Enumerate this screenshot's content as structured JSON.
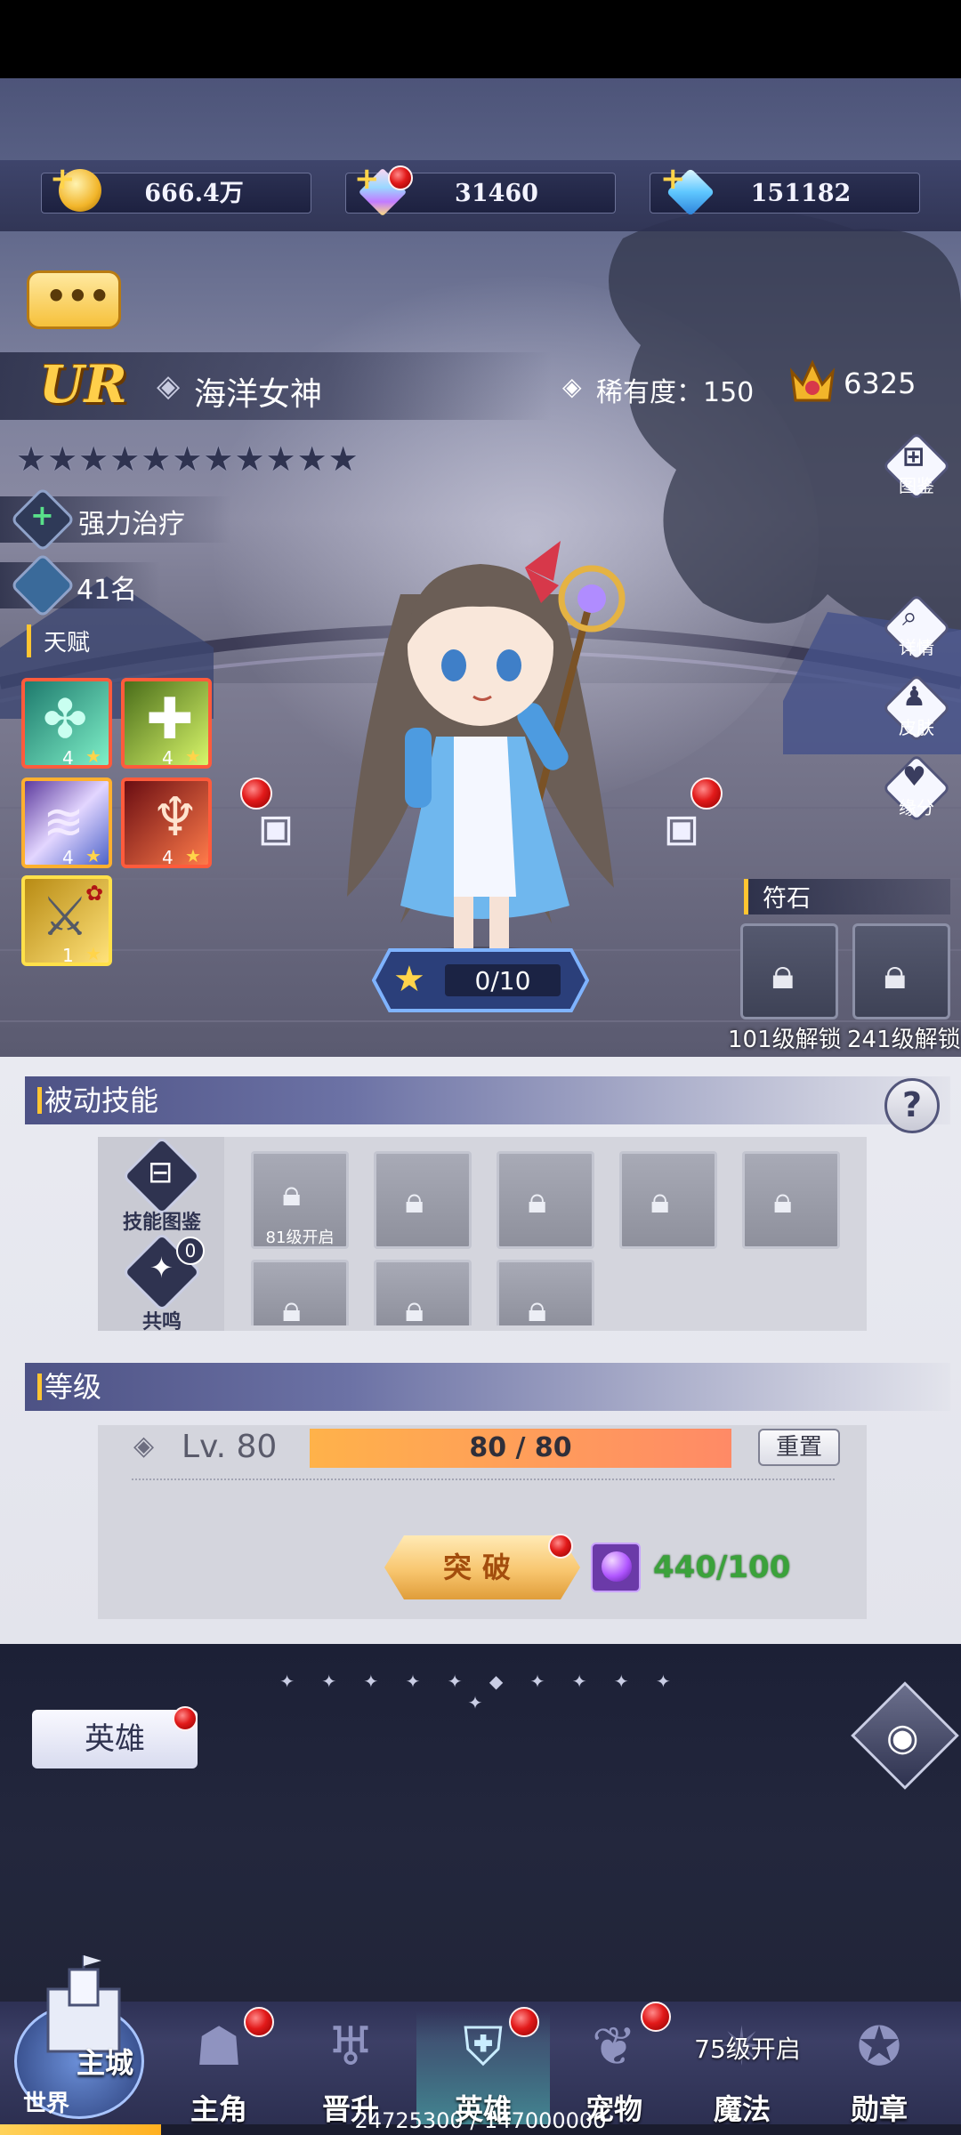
{
  "resources": {
    "gold": "666.4万",
    "gems": "31460",
    "crystals": "151182"
  },
  "hero": {
    "grade": "UR",
    "name": "海洋女神",
    "rarity_label": "稀有度：150",
    "power": "6325",
    "stars": "★★★★★★★★★★★",
    "role_tag": "强力治疗",
    "rank_tag": "41名",
    "talent_title": "天赋",
    "talent_skills": [
      {
        "level": "4",
        "icon": "clover-heal-icon"
      },
      {
        "level": "4",
        "icon": "cross-heal-icon"
      },
      {
        "level": "4",
        "icon": "wave-icon"
      },
      {
        "level": "4",
        "icon": "spirit-icon"
      },
      {
        "level": "1",
        "icon": "blade-icon"
      }
    ],
    "star_progress": "0/10"
  },
  "side_menu": {
    "codex": "图鉴",
    "detail": "详情",
    "skin": "皮肤",
    "bond": "缘分"
  },
  "runes": {
    "title": "符石",
    "slots": [
      "101级解锁",
      "241级解锁"
    ]
  },
  "passive": {
    "title": "被动技能",
    "help": "?",
    "skill_codex": "技能图鉴",
    "resonance": "共鸣",
    "resonance_count": "0",
    "first_slot_label": "81级开启"
  },
  "level": {
    "title": "等级",
    "lv_text": "Lv. 80",
    "exp_text": "80 / 80",
    "exp_fraction": 1.0,
    "reset": "重置",
    "break_button": "突破",
    "materials": "440/100"
  },
  "bottom": {
    "hero_button": "英雄",
    "divider": "✦ ✦ ✦ ✦ ✦ ◆ ✦ ✦ ✦ ✦ ✦"
  },
  "nav": {
    "city_top": "主城",
    "city_bottom": "世界",
    "items": [
      "主角",
      "晋升",
      "英雄",
      "宠物",
      "魔法",
      "勋章"
    ],
    "magic_unlock": "75级开启",
    "exp_text": "24725300 / 147000000",
    "exp_fraction": 0.168
  },
  "colors": {
    "accent_gold": "#ffc531",
    "active_tab": "#5adcd2",
    "materials_green": "#3ba23b"
  }
}
